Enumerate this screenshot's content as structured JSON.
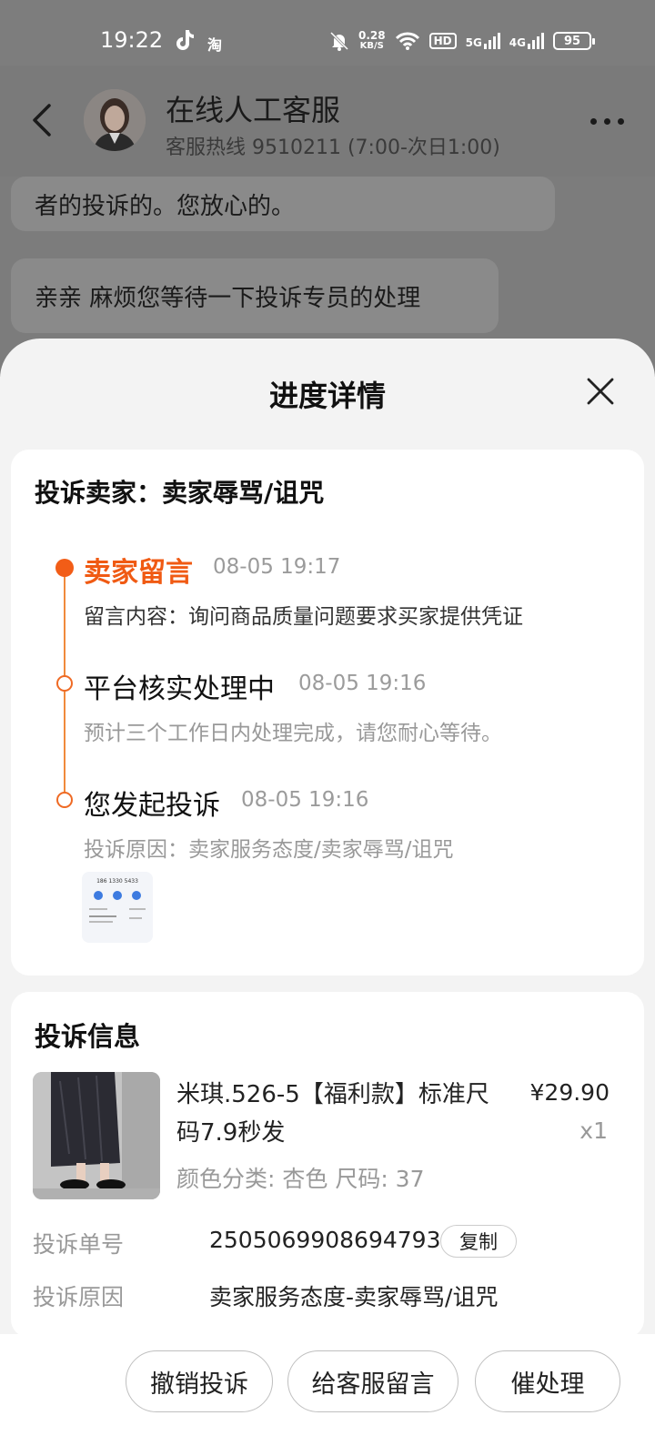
{
  "status_bar": {
    "time": "19:22",
    "taobao": "淘",
    "speed_value": "0.28",
    "speed_unit": "KB/S",
    "hd": "HD",
    "net1": "5G",
    "net2": "4G",
    "battery": "95"
  },
  "chat_header": {
    "title": "在线人工客服",
    "subtitle": "客服热线 9510211 (7:00-次日1:00)"
  },
  "chat": {
    "bubble_1": "者的投诉的。您放心的。",
    "bubble_2": "亲亲 麻烦您等待一下投诉专员的处理"
  },
  "sheet": {
    "title": "进度详情",
    "complaint_header": "投诉卖家：卖家辱骂/诅咒",
    "timeline": [
      {
        "title": "卖家留言",
        "time": "08-05 19:17",
        "desc": "留言内容：询问商品质量问题要求买家提供凭证"
      },
      {
        "title": "平台核实处理中",
        "time": "08-05 19:16",
        "desc": "预计三个工作日内处理完成，请您耐心等待。"
      },
      {
        "title": "您发起投诉",
        "time": "08-05 19:16",
        "desc": "投诉原因：卖家服务态度/卖家辱骂/诅咒"
      }
    ],
    "thumb_text": "186 1330 5433"
  },
  "info": {
    "title": "投诉信息",
    "product_name": "米琪.526-5【福利款】标准尺码7.9秒发",
    "price": "¥29.90",
    "qty": "x1",
    "sku": "颜色分类: 杏色 尺码: 37",
    "order_label": "投诉单号",
    "order_value": "2505069908694793",
    "copy_label": "复制",
    "reason_label": "投诉原因",
    "reason_value": "卖家服务态度-卖家辱骂/诅咒"
  },
  "actions": {
    "cancel": "撤销投诉",
    "message": "给客服留言",
    "urge": "催处理"
  },
  "colors": {
    "accent": "#f05a13",
    "timeline_line": "#f08a3c",
    "overlay": "#7d7d7d"
  }
}
